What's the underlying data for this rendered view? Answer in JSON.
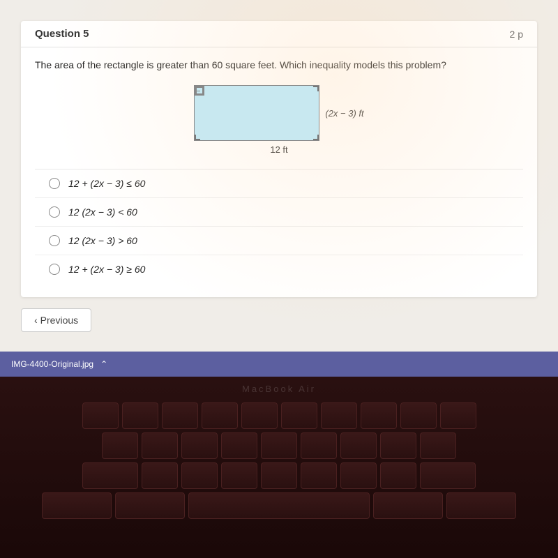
{
  "header": {
    "question_number": "Question 5",
    "points": "2 p"
  },
  "question": {
    "text": "The area of the rectangle is greater than 60 square feet. Which inequality models this problem?",
    "diagram": {
      "side_label": "(2x − 3) ft",
      "bottom_label": "12 ft"
    },
    "options": [
      {
        "id": "A",
        "text": "12 + (2x − 3) ≤ 60"
      },
      {
        "id": "B",
        "text": "12 (2x − 3) < 60"
      },
      {
        "id": "C",
        "text": "12 (2x − 3) > 60"
      },
      {
        "id": "D",
        "text": "12 + (2x − 3) ≥ 60"
      }
    ]
  },
  "buttons": {
    "previous": "Previous"
  },
  "download_bar": {
    "filename": "IMG-4400-Original.jpg"
  },
  "macbook_label": "MacBook Air"
}
